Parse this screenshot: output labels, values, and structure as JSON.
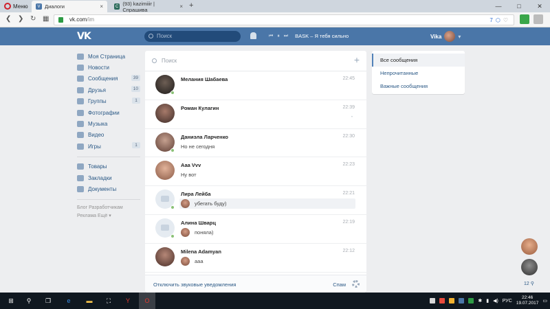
{
  "browser": {
    "menu_label": "Меню",
    "tabs": [
      {
        "label": "Диалоги",
        "close": "×"
      },
      {
        "label": "(93) kazimiiir | Спрашива",
        "close": "×"
      }
    ],
    "new_tab": "+",
    "url_host": "vk.com",
    "url_path": "/im",
    "url_badge": "7"
  },
  "vk": {
    "logo": "VK",
    "search_placeholder": "Поиск",
    "player_track": "BASK – Я тебя сильно",
    "user_name": "Vika"
  },
  "left_menu": {
    "items": [
      {
        "label": "Моя Страница",
        "count": ""
      },
      {
        "label": "Новости",
        "count": ""
      },
      {
        "label": "Сообщения",
        "count": "39"
      },
      {
        "label": "Друзья",
        "count": "10"
      },
      {
        "label": "Группы",
        "count": "1"
      },
      {
        "label": "Фотографии",
        "count": ""
      },
      {
        "label": "Музыка",
        "count": ""
      },
      {
        "label": "Видео",
        "count": ""
      },
      {
        "label": "Игры",
        "count": "1"
      }
    ],
    "items2": [
      {
        "label": "Товары"
      },
      {
        "label": "Закладки"
      },
      {
        "label": "Документы"
      }
    ],
    "footer_line1": "Блог   Разработчикам",
    "footer_line2": "Реклама   Ещё ▾"
  },
  "dialogs": {
    "search_placeholder": "Поиск",
    "add": "+",
    "items": [
      {
        "name": "Мелания Шабаева",
        "time": "22:45",
        "message": ""
      },
      {
        "name": "Роман Кулагин",
        "time": "22:39",
        "message": ""
      },
      {
        "name": "Даниэла Ларченко",
        "time": "22:30",
        "message": "Но не сегодня"
      },
      {
        "name": "Ааа Vvv",
        "time": "22:23",
        "message": "Ну вот"
      },
      {
        "name": "Лира Лейба",
        "time": "22:21",
        "message": "убегать буду)"
      },
      {
        "name": "Алина Шварц",
        "time": "22:19",
        "message": "поняла)"
      },
      {
        "name": "Milena Adamyan",
        "time": "22:12",
        "message": "ааа"
      }
    ],
    "footer_left": "Отключить звуковые уведомления",
    "footer_right": "Спам"
  },
  "filters": {
    "items": [
      "Все сообщения",
      "Непрочитанные",
      "Важные сообщения"
    ]
  },
  "side_chats": {
    "count": "12"
  },
  "taskbar": {
    "lang": "РУС",
    "time": "22:46",
    "date": "19.07.2017"
  }
}
